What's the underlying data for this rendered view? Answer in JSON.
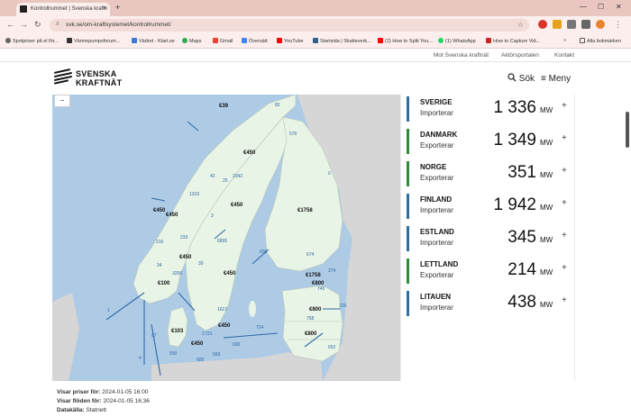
{
  "browser": {
    "tab_title": "Kontrollrummet | Svenska kraftn",
    "tab_close": "×",
    "new_tab": "+",
    "url": "svk.se/om-kraftsystemet/kontrollrummet/",
    "win_min": "—",
    "win_max": "☐",
    "win_close": "✕",
    "bookmarks": [
      "Spotpriser på el för...",
      "Värmepumpsforum...",
      "Vädret - Klart.se",
      "Maps",
      "Gmail",
      "Översätt",
      "YouTube",
      "Startsida | Skatteverk...",
      "(2) How to Split You...",
      "(1) WhatsApp",
      "How to Capture Vid...",
      "Alla bokmärken"
    ],
    "bookmarks_more": "»"
  },
  "site": {
    "toplinks": [
      "Mot Svenska kraftnät",
      "Aktörsportalen",
      "Kontakt"
    ],
    "logo_line1": "SVENSKA",
    "logo_line2": "KRAFTNÄT",
    "search_label": "Sök",
    "menu_label": "Meny",
    "search_icon": "magnifier-icon",
    "menu_icon": "hamburger-icon"
  },
  "map": {
    "zoom_out": "−",
    "price_labels": [
      {
        "text": "€39"
      },
      {
        "text": "€450"
      },
      {
        "text": "€450"
      },
      {
        "text": "€450"
      },
      {
        "text": "€450"
      },
      {
        "text": "€1758"
      },
      {
        "text": "€450"
      },
      {
        "text": "€450"
      },
      {
        "text": "€100"
      },
      {
        "text": "€1758"
      },
      {
        "text": "€800"
      },
      {
        "text": "€103"
      },
      {
        "text": "€450"
      },
      {
        "text": "€450"
      },
      {
        "text": "€800"
      },
      {
        "text": "€800"
      }
    ],
    "flow_labels": [
      {
        "text": "82"
      },
      {
        "text": "576"
      },
      {
        "text": "25"
      },
      {
        "text": "42"
      },
      {
        "text": "2342"
      },
      {
        "text": "1316"
      },
      {
        "text": "3"
      },
      {
        "text": "233"
      },
      {
        "text": "216"
      },
      {
        "text": "6895"
      },
      {
        "text": "34"
      },
      {
        "text": "3206"
      },
      {
        "text": "39"
      },
      {
        "text": "0"
      },
      {
        "text": "606"
      },
      {
        "text": "674"
      },
      {
        "text": "274"
      },
      {
        "text": "745"
      },
      {
        "text": "225"
      },
      {
        "text": "1627"
      },
      {
        "text": "758"
      },
      {
        "text": "724"
      },
      {
        "text": "1723"
      },
      {
        "text": "600"
      },
      {
        "text": "590"
      },
      {
        "text": "600"
      },
      {
        "text": "569"
      },
      {
        "text": "652"
      },
      {
        "text": "87"
      },
      {
        "text": "4"
      },
      {
        "text": "1"
      }
    ]
  },
  "panel": {
    "unit": "MW",
    "plus": "+",
    "rows": [
      {
        "name": "SVERIGE",
        "direction": "Importerar",
        "value": "1 336",
        "color": "#2e6e9e"
      },
      {
        "name": "DANMARK",
        "direction": "Exporterar",
        "value": "1 349",
        "color": "#2e8b3a"
      },
      {
        "name": "NORGE",
        "direction": "Exporterar",
        "value": "351",
        "color": "#2e8b3a"
      },
      {
        "name": "FINLAND",
        "direction": "Importerar",
        "value": "1 942",
        "color": "#2e6e9e"
      },
      {
        "name": "ESTLAND",
        "direction": "Importerar",
        "value": "345",
        "color": "#2e6e9e"
      },
      {
        "name": "LETTLAND",
        "direction": "Exporterar",
        "value": "214",
        "color": "#2e8b3a"
      },
      {
        "name": "LITAUEN",
        "direction": "Importerar",
        "value": "438",
        "color": "#2e6e9e"
      }
    ]
  },
  "footer": {
    "prices_label": "Visar priser för:",
    "prices_value": "2024-01-05 16:00",
    "flows_label": "Visar flöden för:",
    "flows_value": "2024-01-05 16:36",
    "source_label": "Datakälla:",
    "source_value": "Statnett"
  }
}
